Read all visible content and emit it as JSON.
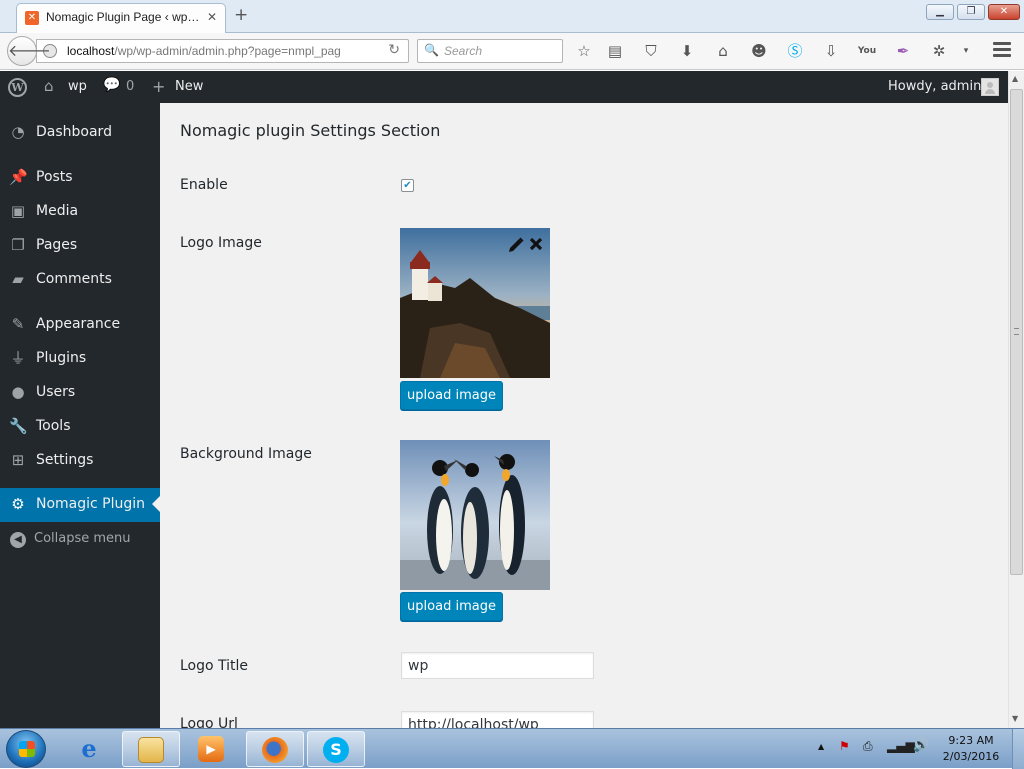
{
  "browser": {
    "tab_title": "Nomagic Plugin Page ‹ wp…",
    "tab_close": "✕",
    "new_tab": "+",
    "url_host": "localhost",
    "url_path": "/wp/wp-admin/admin.php?page=nmpl_pag",
    "search_placeholder": "Search",
    "window_controls": {
      "minimize": "▁",
      "maximize": "❐",
      "close": "✕"
    },
    "toolbar_icons": [
      "bookmark-star-icon",
      "reading-list-icon",
      "pocket-icon",
      "download-icon",
      "home-icon",
      "smiley-icon",
      "skype-icon",
      "downloader-icon",
      "youtube-icon",
      "feather-icon",
      "extension-icon",
      "dropdown-icon",
      "menu-icon"
    ]
  },
  "adminbar": {
    "site_name": "wp",
    "comments_count": "0",
    "new_label": "New",
    "howdy": "Howdy, admin"
  },
  "sidebar": {
    "items": [
      {
        "label": "Dashboard",
        "icon": "dashboard-icon"
      },
      {
        "label": "Posts",
        "icon": "pin-icon"
      },
      {
        "label": "Media",
        "icon": "media-icon"
      },
      {
        "label": "Pages",
        "icon": "pages-icon"
      },
      {
        "label": "Comments",
        "icon": "comment-icon"
      },
      {
        "label": "Appearance",
        "icon": "brush-icon"
      },
      {
        "label": "Plugins",
        "icon": "plug-icon"
      },
      {
        "label": "Users",
        "icon": "user-icon"
      },
      {
        "label": "Tools",
        "icon": "wrench-icon"
      },
      {
        "label": "Settings",
        "icon": "settings-icon"
      },
      {
        "label": "Nomagic Plugin",
        "icon": "gear-icon"
      }
    ],
    "active": "Nomagic Plugin",
    "collapse_label": "Collapse menu"
  },
  "settings": {
    "section_title": "Nomagic plugin Settings Section",
    "enable_label": "Enable",
    "enable_checked": true,
    "logo_image_label": "Logo Image",
    "upload_button": "upload image",
    "background_image_label": "Background Image",
    "logo_title_label": "Logo Title",
    "logo_title_value": "wp",
    "logo_url_label": "Logo Url",
    "logo_url_value": "http://localhost/wp"
  },
  "taskbar": {
    "time": "9:23 AM",
    "date": "2/03/2016",
    "apps": [
      "internet-explorer-icon",
      "file-explorer-icon",
      "media-player-icon",
      "firefox-icon",
      "skype-icon"
    ]
  },
  "colors": {
    "admin_dark": "#23282d",
    "wp_blue": "#0073aa",
    "button_blue": "#0085ba",
    "content_bg": "#f1f1f1"
  }
}
